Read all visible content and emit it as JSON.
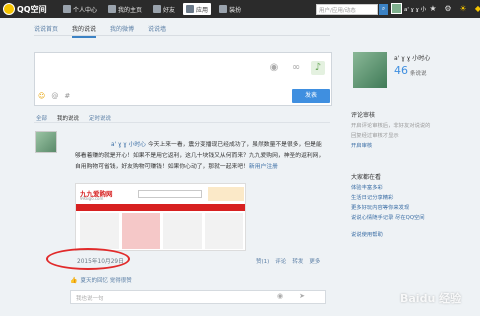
{
  "topbar": {
    "logo_text": "QQ空间",
    "nav": [
      {
        "label": "个人中心",
        "icon": "person-icon"
      },
      {
        "label": "我的主页",
        "icon": "home-icon"
      },
      {
        "label": "好友",
        "icon": "friends-icon"
      },
      {
        "label": "应用",
        "icon": "apps-icon"
      },
      {
        "label": "装扮",
        "icon": "shirt-icon"
      }
    ],
    "search_placeholder": "用户/应用/动态",
    "username": "a' ɣ ɣ 小时心",
    "icons": [
      "star-icon",
      "settings-icon",
      "sun-icon",
      "diamond-icon"
    ]
  },
  "tabs": [
    "说说首页",
    "我的说说",
    "我的微博",
    "说说墙"
  ],
  "composer": {
    "tools": [
      "camera-icon",
      "link-icon",
      "music-icon"
    ],
    "footer_icons": [
      "emoji-icon",
      "at-icon",
      "hashtag-icon"
    ],
    "publish_label": "发表"
  },
  "filters": [
    "全部",
    "我的说说",
    "定时说说"
  ],
  "post": {
    "author": "a' ɣ ɣ 小时心",
    "body_prefix": "今天上来一看，震分变播现已经成功了，虽然数量不是很多，但是能够看着赚的就是开心！如果不是用它返利，这几十块钱又从何而来？九九爱购网，神圣的返利网，自用购物可省钱，好友购物可赚钱！如果你心动了，那就一起来吧！",
    "body_link": "新用户注册",
    "image": {
      "logo": "九九爱购网",
      "sublogo": "99aigo.com"
    },
    "date": "2015年10月29日",
    "actions": [
      "赞(1)",
      "评论",
      "转发",
      "更多"
    ],
    "likes": "夏天的回忆 觉得很赞",
    "comment_placeholder": "我也说一句"
  },
  "sidebar": {
    "name": "a' ɣ ɣ 小时心",
    "count": "46",
    "count_label": "条说说",
    "review_title": "评论审核",
    "review_text": [
      "开启评论审核后，非好友对说说的",
      "回复经过审核才显示",
      "开启审核"
    ],
    "hot_title": "大家都在看",
    "hot_items": [
      "体验丰富多彩",
      "生活日记分享精彩",
      "更多好玩内容等你来发现",
      "说说心情随手记录 尽在QQ空间"
    ],
    "help": "说说使用帮助"
  },
  "watermark": "Baidu 经验"
}
